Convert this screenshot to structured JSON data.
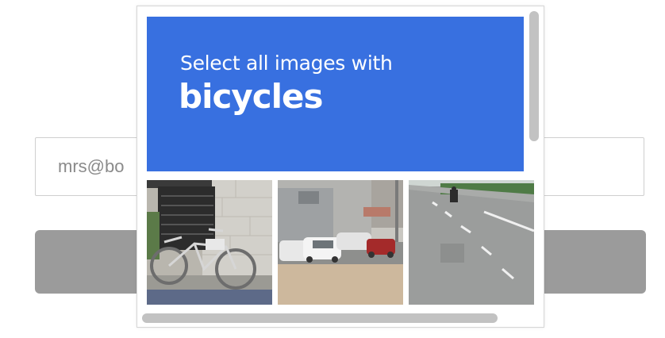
{
  "form": {
    "email_value": "mrs@bo"
  },
  "captcha": {
    "instruction": "Select all images with",
    "target": "bicycles",
    "tiles": [
      {
        "depicts": "bicycle parked by a wall"
      },
      {
        "depicts": "parked cars and motorcycle by a building"
      },
      {
        "depicts": "road with distant motorcyclist"
      }
    ]
  },
  "colors": {
    "header_bg": "#3870e0",
    "button_bg": "#9b9b9b"
  }
}
